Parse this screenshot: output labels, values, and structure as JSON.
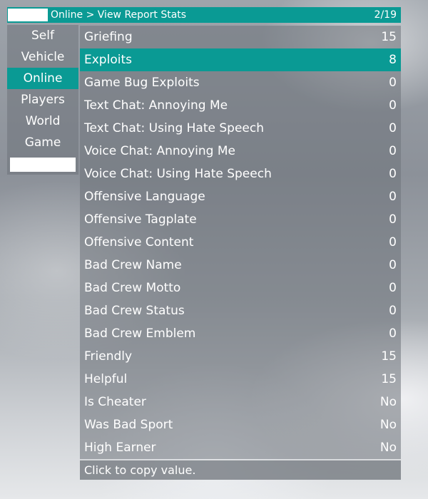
{
  "header": {
    "breadcrumb": "Online > View Report Stats",
    "page_indicator": "2/19"
  },
  "sidebar": {
    "items": [
      {
        "label": "Self",
        "active": false
      },
      {
        "label": "Vehicle",
        "active": false
      },
      {
        "label": "Online",
        "active": true
      },
      {
        "label": "Players",
        "active": false
      },
      {
        "label": "World",
        "active": false
      },
      {
        "label": "Game",
        "active": false
      }
    ]
  },
  "list": {
    "rows": [
      {
        "label": "Griefing",
        "value": "15",
        "active": false
      },
      {
        "label": "Exploits",
        "value": "8",
        "active": true
      },
      {
        "label": "Game Bug Exploits",
        "value": "0",
        "active": false
      },
      {
        "label": "Text Chat: Annoying Me",
        "value": "0",
        "active": false
      },
      {
        "label": "Text Chat: Using Hate Speech",
        "value": "0",
        "active": false
      },
      {
        "label": "Voice Chat: Annoying Me",
        "value": "0",
        "active": false
      },
      {
        "label": "Voice Chat: Using Hate Speech",
        "value": "0",
        "active": false
      },
      {
        "label": "Offensive Language",
        "value": "0",
        "active": false
      },
      {
        "label": "Offensive Tagplate",
        "value": "0",
        "active": false
      },
      {
        "label": "Offensive Content",
        "value": "0",
        "active": false
      },
      {
        "label": "Bad Crew Name",
        "value": "0",
        "active": false
      },
      {
        "label": "Bad Crew Motto",
        "value": "0",
        "active": false
      },
      {
        "label": "Bad Crew Status",
        "value": "0",
        "active": false
      },
      {
        "label": "Bad Crew Emblem",
        "value": "0",
        "active": false
      },
      {
        "label": "Friendly",
        "value": "15",
        "active": false
      },
      {
        "label": "Helpful",
        "value": "15",
        "active": false
      },
      {
        "label": "Is Cheater",
        "value": "No",
        "active": false
      },
      {
        "label": "Was Bad Sport",
        "value": "No",
        "active": false
      },
      {
        "label": "High Earner",
        "value": "No",
        "active": false
      }
    ]
  },
  "status_bar": {
    "text": "Click to copy value."
  },
  "colors": {
    "accent": "#0a9a94"
  }
}
